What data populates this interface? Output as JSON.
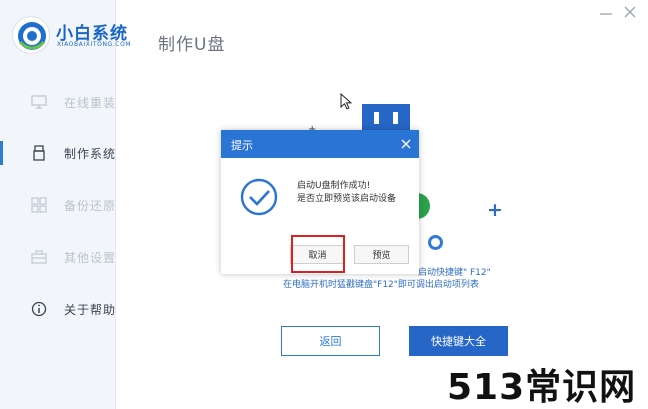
{
  "app": {
    "name": "小白系统",
    "subtitle": "XIAOBAIXITONG.COM",
    "page_title": "制作U盘"
  },
  "sidebar": {
    "items": [
      {
        "label": "在线重装",
        "icon": "monitor-icon",
        "active": false
      },
      {
        "label": "制作系统",
        "icon": "usb-icon",
        "active": true
      },
      {
        "label": "备份还原",
        "icon": "backup-grid-icon",
        "active": false
      },
      {
        "label": "其他设置",
        "icon": "toolbox-icon",
        "active": false
      },
      {
        "label": "关于帮助",
        "icon": "info-icon",
        "active": false
      }
    ]
  },
  "main": {
    "hint_line1": "启动快捷键\" F12\"",
    "hint_line2": "在电脑开机时猛戳键盘\"F12\"即可调出启动项列表",
    "back_button": "返回",
    "shortcut_button": "快捷键大全"
  },
  "dialog": {
    "title": "提示",
    "message_line1": "启动U盘制作成功!",
    "message_line2": "是否立即预览该启动设备",
    "cancel_button": "取消",
    "preview_button": "预览"
  },
  "watermark": "513常识网",
  "colors": {
    "accent": "#2a74d6",
    "highlight": "#e02020",
    "success_green": "#2aa24a"
  }
}
